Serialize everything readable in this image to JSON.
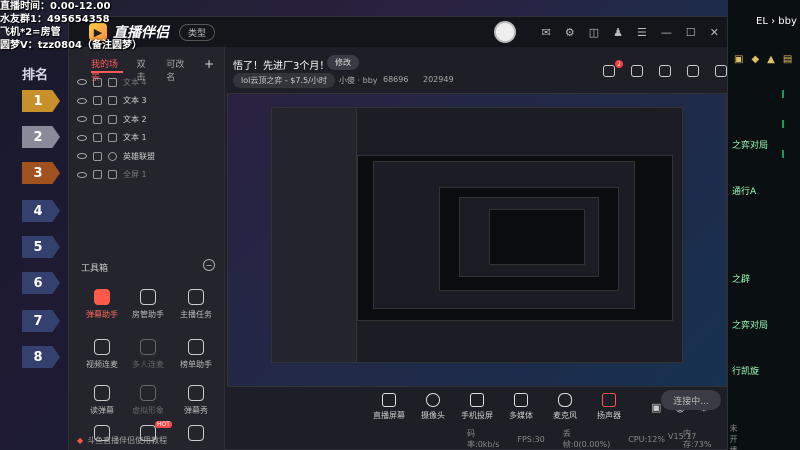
{
  "overlay": {
    "lines": [
      "直播时间：0.00-12.00",
      "水友群1：495654358",
      "飞机*2=房管",
      "圆梦V：tzz0804（备注圆梦）"
    ]
  },
  "rank": {
    "title": "排名",
    "numbers": [
      "1",
      "2",
      "3",
      "4",
      "5",
      "6",
      "7",
      "8"
    ],
    "colors": [
      "#c8902a",
      "#b8b8c8",
      "#b86a2a",
      "#4a5a8a",
      "#4a5a8a",
      "#4a5a8a",
      "#4a5a8a",
      "#4a5a8a"
    ]
  },
  "app": {
    "name": "直播伴侣",
    "type_button": "类型"
  },
  "scenes": {
    "tabs": [
      "我的场景",
      "双击",
      "可改名"
    ],
    "plus": "+",
    "items": [
      "文本 4",
      "文本 3",
      "文本 2",
      "文本 1",
      "英雄联盟",
      "全屏 1"
    ]
  },
  "tools": {
    "header": "工具箱",
    "collapse": "−",
    "items": [
      "弹幕助手",
      "房管助手",
      "主播任务",
      "视频连麦",
      "多人连麦",
      "榜单助手",
      "读弹幕",
      "虚拟形象",
      "弹幕秀"
    ],
    "hot_label": "HOT"
  },
  "footer": {
    "tutorial": "斗鱼直播伴侣使用教程"
  },
  "stream": {
    "title": "悟了！先进厂3个月！",
    "edit": "修改",
    "category": "lol云顶之弈 - $7.5/小时",
    "streamer": "小傻 · bby",
    "stat1": "68696",
    "stat2": "202949"
  },
  "bottom_bar": [
    "直播屏幕",
    "摄像头",
    "手机投屏",
    "多媒体",
    "麦克风",
    "扬声器"
  ],
  "go_live": "连接中...",
  "status": [
    "码率:0kb/s",
    "FPS:30",
    "丢帧:0(0.00%)",
    "CPU:12%",
    "内存:73%",
    "未开播"
  ],
  "version": "V15.17",
  "right_strip": {
    "top_text": "EL › bby",
    "lines": [
      "之弈对局",
      "通行A",
      "之辟",
      "之弈对局",
      "行凯旋"
    ]
  }
}
